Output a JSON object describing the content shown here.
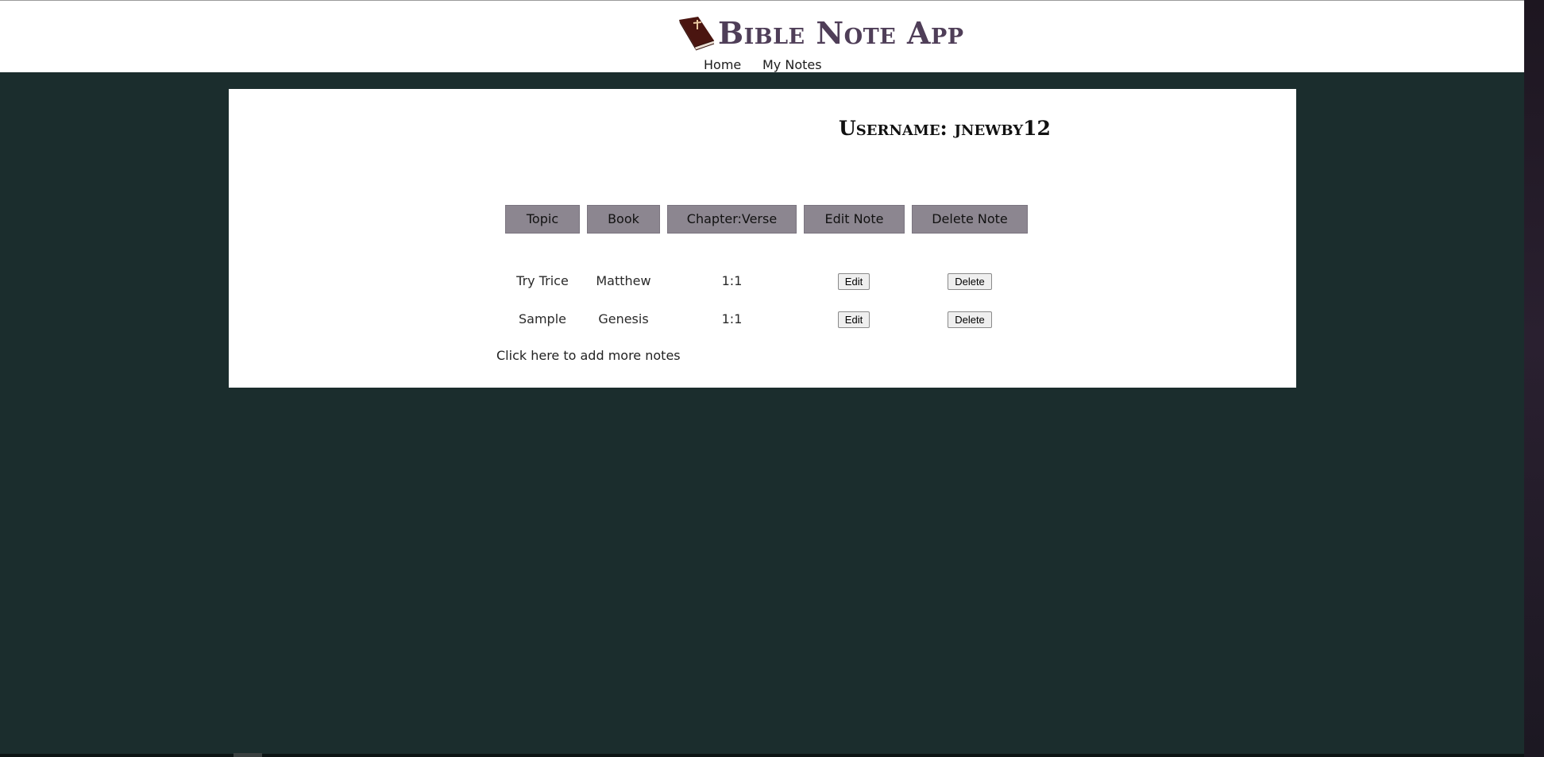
{
  "header": {
    "title": "Bible Note App",
    "logo_icon": "bible-book-icon",
    "brand_color": "#4f3e58",
    "nav": [
      {
        "label": "Home"
      },
      {
        "label": "My Notes"
      }
    ]
  },
  "page": {
    "background_color": "#1b2d2d"
  },
  "profile": {
    "username_text": "Username: jnewby12"
  },
  "notes_table": {
    "header_color": "#8c8690",
    "columns": [
      "Topic",
      "Book",
      "Chapter:Verse",
      "Edit Note",
      "Delete Note"
    ],
    "rows": [
      {
        "topic": "Try Trice",
        "book": "Matthew",
        "chapter_verse": "1:1",
        "edit_label": "Edit",
        "delete_label": "Delete"
      },
      {
        "topic": "Sample",
        "book": "Genesis",
        "chapter_verse": "1:1",
        "edit_label": "Edit",
        "delete_label": "Delete"
      }
    ],
    "add_more_label": "Click here to add more notes"
  }
}
